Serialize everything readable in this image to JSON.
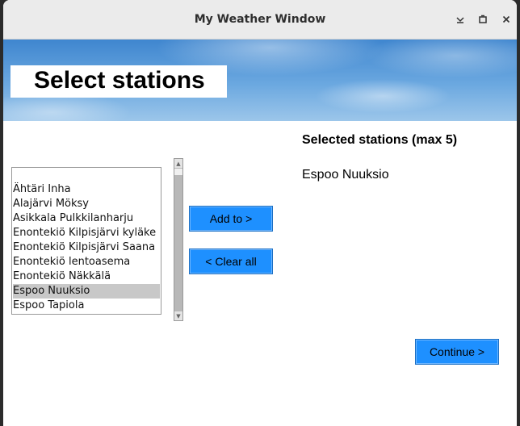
{
  "window": {
    "title": "My Weather Window"
  },
  "banner": {
    "title": "Select stations"
  },
  "stations": {
    "items": [
      "Ähtäri Inha",
      "Alajärvi Möksy",
      "Asikkala Pulkkilanharju",
      "Enontekiö Kilpisjärvi kyläke",
      "Enontekiö Kilpisjärvi Saana",
      "Enontekiö lentoasema",
      "Enontekiö Näkkälä",
      "Espoo Nuuksio",
      "Espoo Tapiola"
    ],
    "selected_item": "Espoo Nuuksio"
  },
  "buttons": {
    "add": "Add to >",
    "clear": "< Clear all",
    "continue": "Continue >"
  },
  "selected": {
    "heading": "Selected stations (max 5)",
    "items": [
      "Espoo Nuuksio"
    ]
  },
  "colors": {
    "button": "#1e90ff",
    "selection": "#c8c8c8"
  }
}
